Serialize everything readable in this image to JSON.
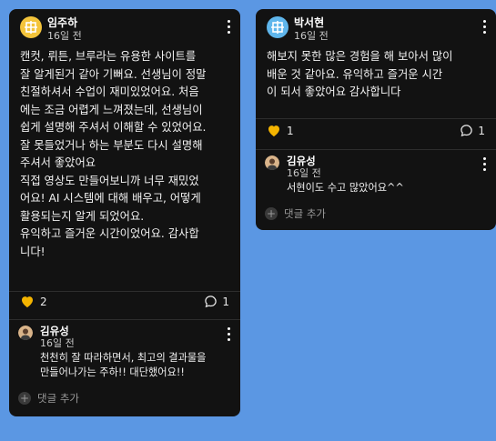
{
  "cards": [
    {
      "author": "임주하",
      "time": "16일 전",
      "avatar_color": "#f4c43b",
      "body": "캔컷, 뤼튼, 브루라는 유용한 사이트를\n잘 알게된거 같아 기뻐요. 선생님이 정말\n친절하셔서 수업이 재미있었어요. 처음\n에는 조금 어렵게 느껴졌는데, 선생님이\n쉽게 설명해 주셔서 이해할 수 있었어요.\n잘 못들었거나 하는 부분도 다시 설명해\n주셔서 좋았어요\n직접 영상도 만들어보니까 너무 재밌었\n어요! AI 시스템에 대해 배우고, 어떻게\n활용되는지 알게 되었어요.\n유익하고 즐거운 시간이었어요. 감사합\n니다!",
      "likes": "2",
      "comments": "1",
      "reply": {
        "author": "김유성",
        "time": "16일 전",
        "text": "천천히 잘 따라하면서, 최고의 결과물을 만들어나가는 주하!! 대단했어요!!"
      },
      "add_comment": "댓글 추가"
    },
    {
      "author": "박서현",
      "time": "16일 전",
      "avatar_color": "#5fb6ec",
      "body": "해보지 못한 많은 경험을 해 보아서 많이\n배운 것 같아요. 유익하고 즐거운 시간\n이 되서 좋았어요 감사합니다",
      "likes": "1",
      "comments": "1",
      "reply": {
        "author": "김유성",
        "time": "16일 전",
        "text": "서현이도 수고 많았어요^^"
      },
      "add_comment": "댓글 추가"
    }
  ],
  "colors": {
    "background": "#5b97e3",
    "card": "#121212",
    "heart": "#f4b400"
  },
  "icons": [
    "heart-icon",
    "comment-icon",
    "more-vert-icon",
    "plus-icon"
  ]
}
